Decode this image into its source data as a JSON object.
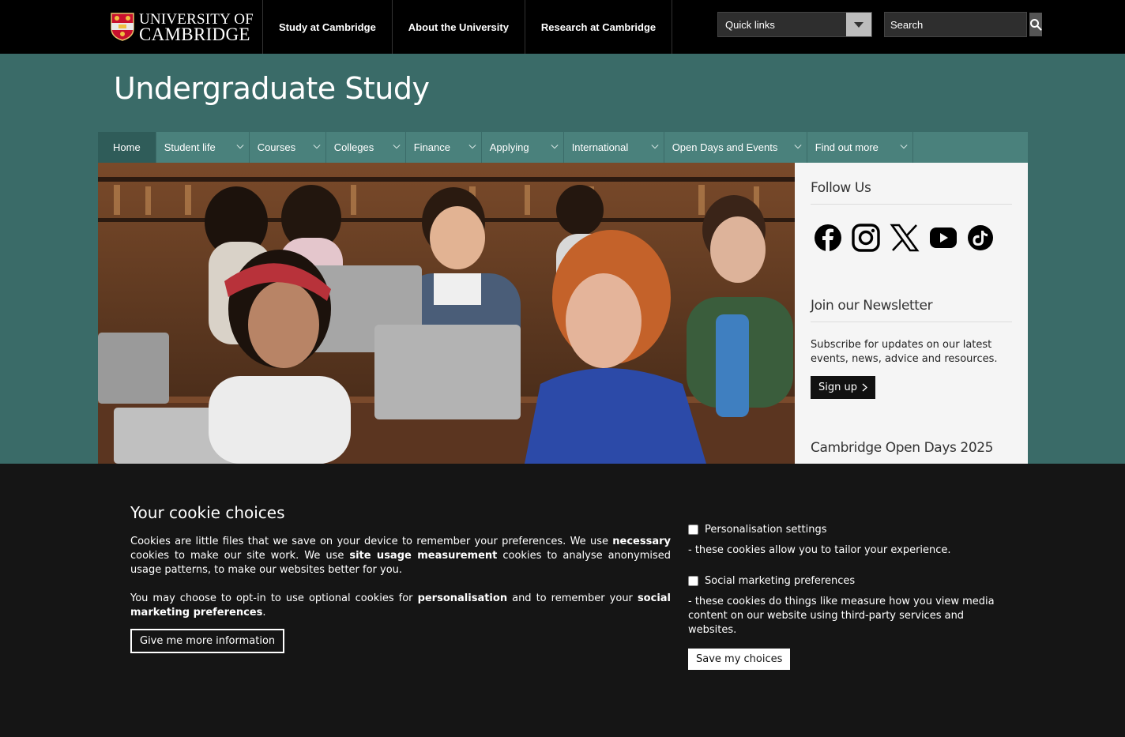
{
  "header": {
    "logo_line1": "UNIVERSITY OF",
    "logo_line2": "CAMBRIDGE",
    "nav": [
      "Study at Cambridge",
      "About the University",
      "Research at Cambridge"
    ],
    "quicklinks_label": "Quick links",
    "search_placeholder": "Search"
  },
  "section": {
    "title": "Undergraduate Study",
    "nav": {
      "home": "Home",
      "items": [
        "Student life",
        "Courses",
        "Colleges",
        "Finance",
        "Applying",
        "International",
        "Open Days and Events",
        "Find out more"
      ]
    }
  },
  "sidebar": {
    "follow_heading": "Follow Us",
    "social_icons": [
      "facebook-icon",
      "instagram-icon",
      "x-icon",
      "youtube-icon",
      "tiktok-icon"
    ],
    "newsletter_heading": "Join our Newsletter",
    "newsletter_text": "Subscribe for updates on our latest events, news, advice and resources.",
    "signup_label": "Sign up",
    "opendays_heading": "Cambridge Open Days 2025"
  },
  "cookie": {
    "title": "Your cookie choices",
    "p1_a": "Cookies are little files that we save on your device to remember your preferences. We use ",
    "p1_b": "necessary",
    "p1_c": " cookies to make our site work. We use ",
    "p1_d": "site usage measurement",
    "p1_e": " cookies to analyse anonymised usage patterns, to make our websites better for you.",
    "p2_a": "You may choose to opt-in to use optional cookies for ",
    "p2_b": "personalisation",
    "p2_c": " and to remember your ",
    "p2_d": "social marketing preferences",
    "p2_e": ".",
    "more_button": "Give me more information",
    "opt1_label": "Personalisation settings",
    "opt1_desc": "- these cookies allow you to tailor your experience.",
    "opt2_label": "Social marketing preferences",
    "opt2_desc": "- these cookies do things like measure how you view media content on our website using third-party services and websites.",
    "save_button": "Save my choices"
  },
  "colors": {
    "header_bg": "#000000",
    "page_bg": "#3a6b68",
    "secnav_bg": "#4a817c",
    "cookie_bg": "#151515"
  }
}
